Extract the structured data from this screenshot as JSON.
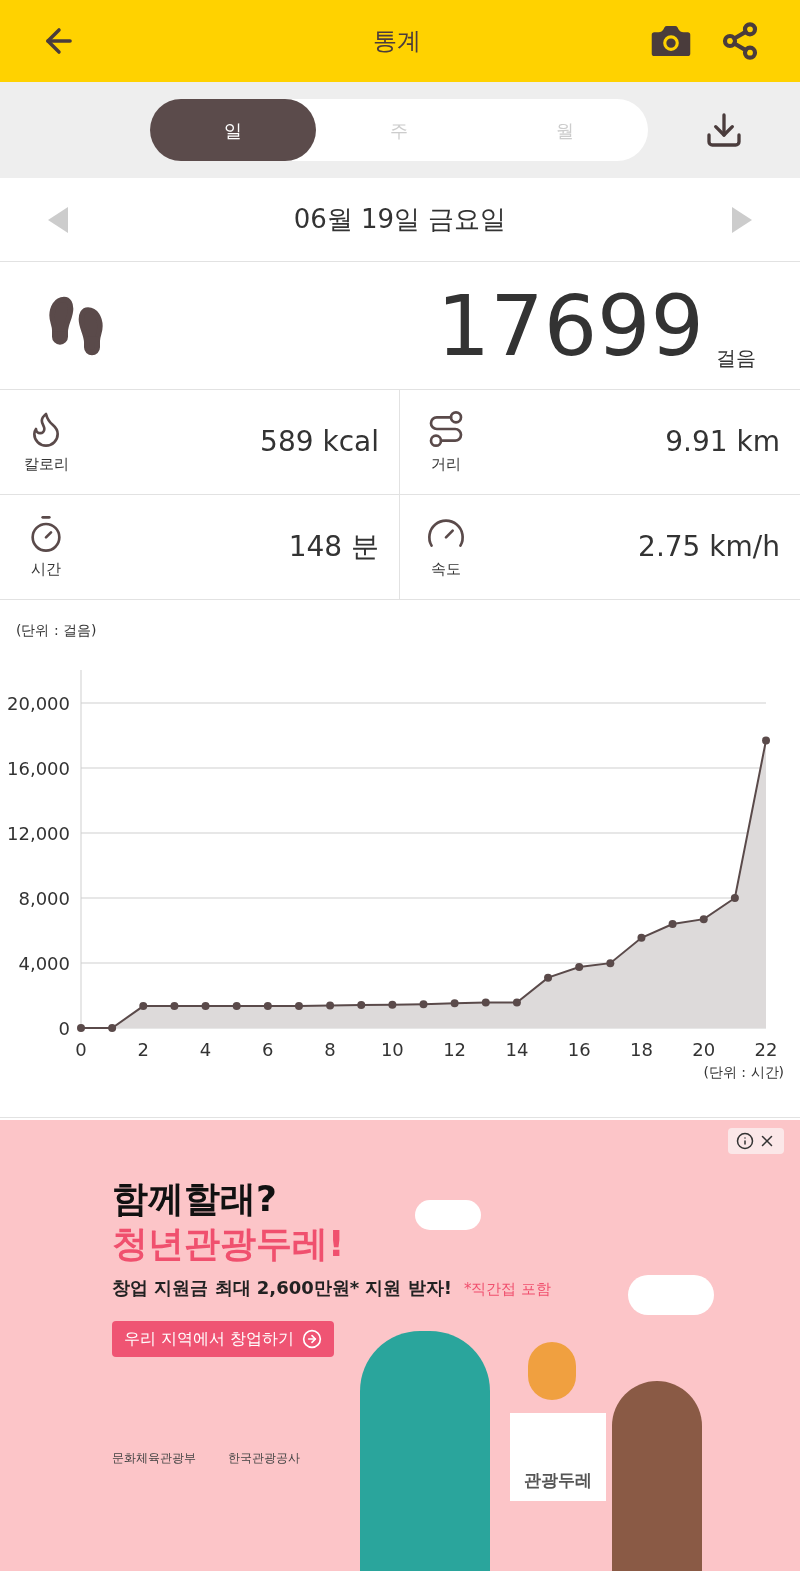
{
  "header": {
    "title": "통계"
  },
  "tabs": [
    {
      "label": "일",
      "selected": true
    },
    {
      "label": "주",
      "selected": false
    },
    {
      "label": "월",
      "selected": false
    }
  ],
  "date": "06월 19일 금요일",
  "steps": {
    "value": "17699",
    "unit": "걸음"
  },
  "stats": [
    {
      "kind": "calories",
      "label": "칼로리",
      "value": "589 kcal"
    },
    {
      "kind": "distance",
      "label": "거리",
      "value": "9.91 km"
    },
    {
      "kind": "time",
      "label": "시간",
      "value": "148 분"
    },
    {
      "kind": "speed",
      "label": "속도",
      "value": "2.75 km/h"
    }
  ],
  "chart": {
    "chart_data": {
      "type": "area",
      "ylabel": "(단위 : 걸음)",
      "xlabel": "(단위 : 시간)",
      "x": [
        0,
        1,
        2,
        3,
        4,
        5,
        6,
        7,
        8,
        9,
        10,
        11,
        12,
        13,
        14,
        15,
        16,
        17,
        18,
        19,
        20,
        21,
        22
      ],
      "series": [
        {
          "color": "#5a4a4a",
          "values": [
            0,
            0,
            1350,
            1350,
            1350,
            1350,
            1350,
            1350,
            1380,
            1420,
            1430,
            1460,
            1530,
            1570,
            1570,
            3100,
            3750,
            3990,
            5550,
            6400,
            6700,
            8000,
            17700
          ]
        }
      ],
      "grid": true,
      "xlim": [
        0,
        22
      ],
      "ylim": [
        0,
        22000
      ],
      "xticks": [
        0,
        2,
        4,
        6,
        8,
        10,
        12,
        14,
        16,
        18,
        20,
        22
      ],
      "yticks": [
        {
          "value": 0,
          "label": "0"
        },
        {
          "value": 4000,
          "label": "4,000"
        },
        {
          "value": 8000,
          "label": "8,000"
        },
        {
          "value": 12000,
          "label": "12,000"
        },
        {
          "value": 16000,
          "label": "16,000"
        },
        {
          "value": 20000,
          "label": "20,000"
        }
      ]
    }
  },
  "ad": {
    "headline": "함께할래?",
    "headline_accent": "청년관광두레!",
    "subline": "창업 지원금 최대 2,600만원* 지원 받자!",
    "note": "*직간접 포함",
    "cta": "우리 지역에서 창업하기",
    "sign": "관광두레",
    "sponsors": [
      "문화체육관광부",
      "한국관광공사"
    ]
  }
}
